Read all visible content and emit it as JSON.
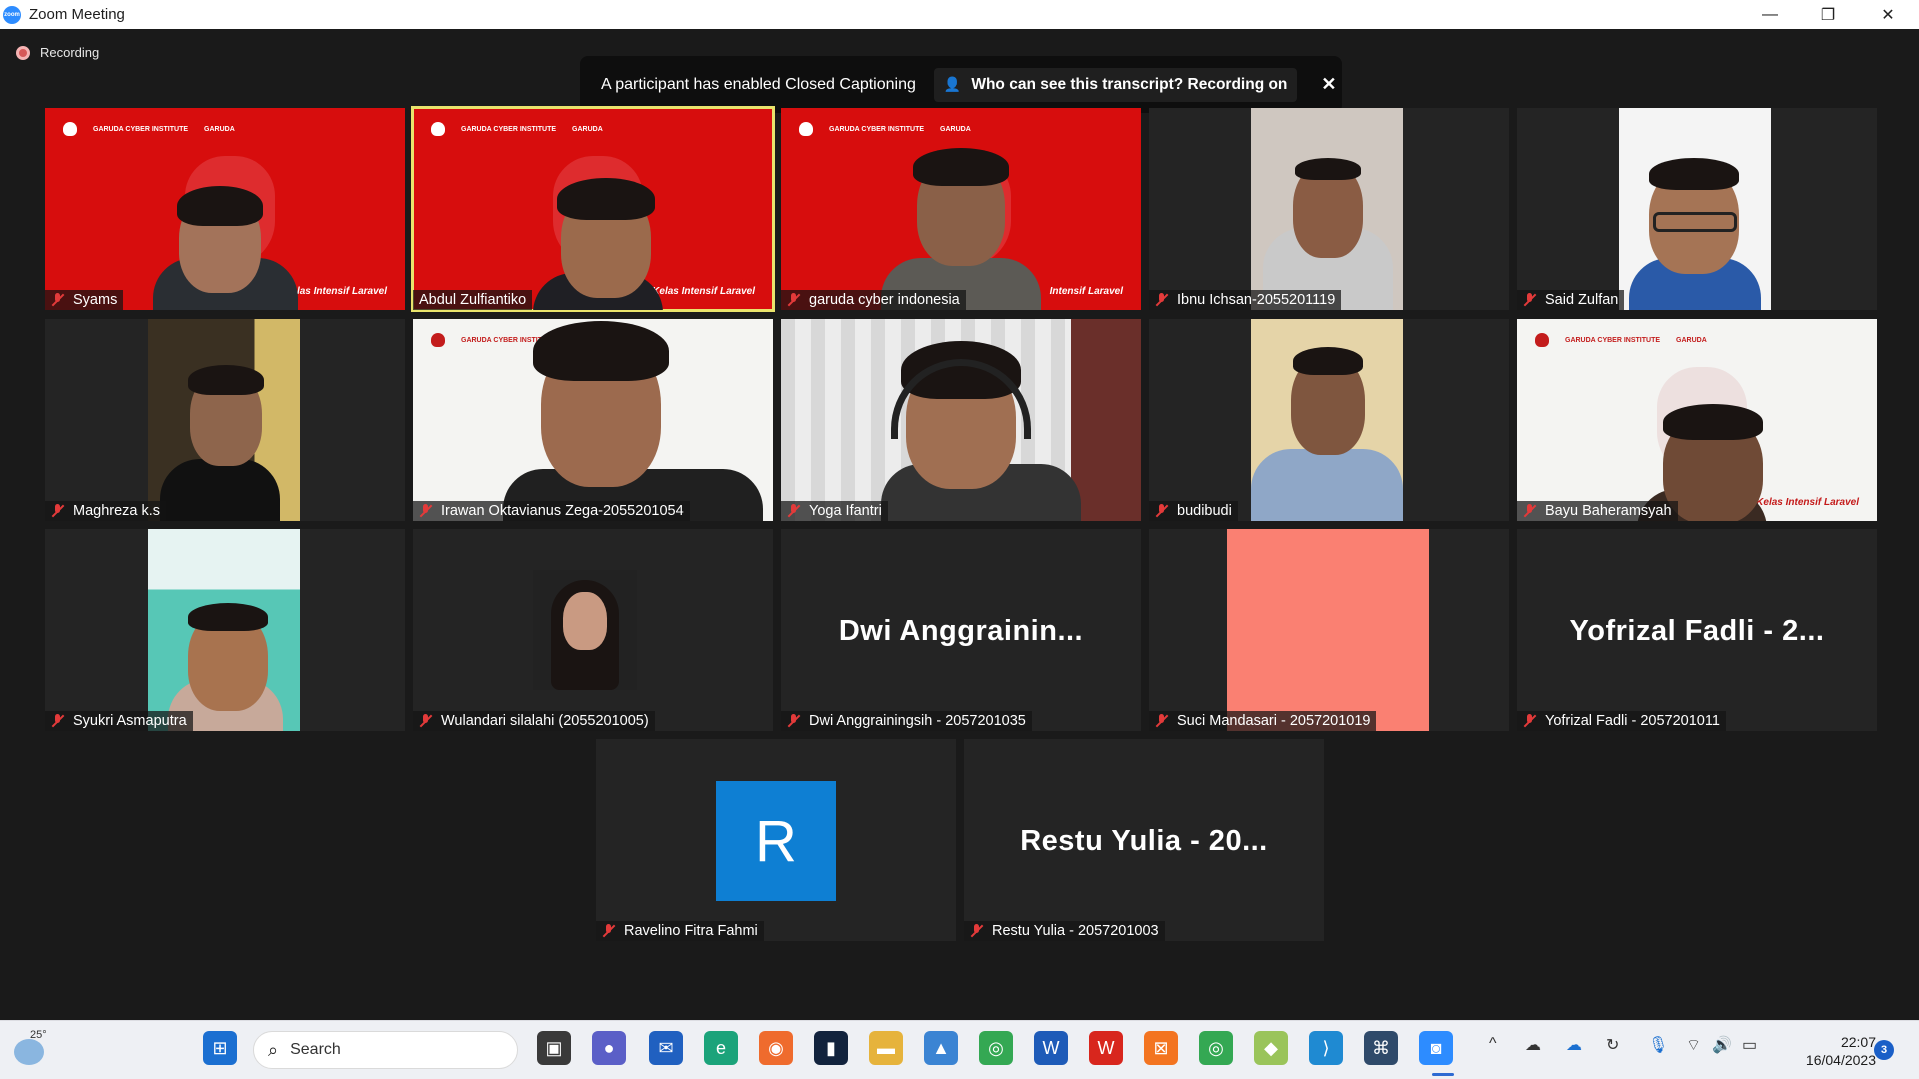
{
  "window": {
    "title": "Zoom Meeting",
    "app_icon": "zoom-app-icon",
    "controls": {
      "minimize": "—",
      "restore": "❐",
      "close": "✕"
    }
  },
  "recording": {
    "label": "Recording"
  },
  "caption_banner": {
    "message": "A participant has enabled Closed Captioning",
    "button_label": "Who can see this transcript? Recording on",
    "close": "✕"
  },
  "branding": {
    "institute": "GARUDA CYBER INSTITUTE",
    "partner": "GARUDA",
    "course_full": "Kelas Intensif Laravel",
    "course_short": "Intensif Laravel"
  },
  "participants": [
    {
      "name": "Syams",
      "muted": true
    },
    {
      "name": "Abdul Zulfiantiko",
      "muted": false,
      "active_speaker": true
    },
    {
      "name": "garuda cyber indonesia",
      "muted": true
    },
    {
      "name": "Ibnu Ichsan-2055201119",
      "muted": true
    },
    {
      "name": "Said Zulfan",
      "muted": true
    },
    {
      "name": "Maghreza k.s",
      "muted": true
    },
    {
      "name": "Irawan Oktavianus Zega-2055201054",
      "muted": true
    },
    {
      "name": "Yoga Ifantri",
      "muted": true
    },
    {
      "name": "budibudi",
      "muted": true
    },
    {
      "name": "Bayu Baheramsyah",
      "muted": true
    },
    {
      "name": "Syukri Asmaputra",
      "muted": true
    },
    {
      "name": "Wulandari silalahi (2055201005)",
      "muted": true
    },
    {
      "name": "Dwi Anggrainingsih - 2057201035",
      "muted": true,
      "display_text": "Dwi  Anggrainin..."
    },
    {
      "name": "Suci Mandasari - 2057201019",
      "muted": true
    },
    {
      "name": "Yofrizal Fadli - 2057201011",
      "muted": true,
      "display_text": "Yofrizal  Fadli  -  2..."
    },
    {
      "name": "Ravelino Fitra Fahmi",
      "muted": true,
      "avatar_letter": "R"
    },
    {
      "name": "Restu Yulia - 2057201003",
      "muted": true,
      "display_text": "Restu  Yulia  -  20..."
    }
  ],
  "taskbar": {
    "weather": "25°",
    "search_placeholder": "Search",
    "time": "22:07",
    "date": "16/04/2023",
    "notifications": "3",
    "apps": [
      "start-icon",
      "task-view-icon",
      "chat-icon",
      "mail-icon",
      "edge-icon",
      "firefox-icon",
      "terminal-icon",
      "file-explorer-icon",
      "photos-icon",
      "chrome-icon",
      "word-icon",
      "wps-icon",
      "xampp-icon",
      "chrome-profile-icon",
      "sourcetree-icon",
      "vscode-icon",
      "ssh-icon",
      "zoom-icon"
    ],
    "tray": [
      "chevron-up-icon",
      "cloud-icon",
      "onedrive-icon",
      "sync-icon",
      "microphone-icon",
      "wifi-icon",
      "volume-icon",
      "battery-icon"
    ]
  },
  "colors": {
    "accent_speaker": "#e9e36c",
    "brand_red": "#d70d0d",
    "zoom_blue": "#2d8cff",
    "avatar_blue": "#0e7fd3",
    "salmon": "#fa8072"
  }
}
